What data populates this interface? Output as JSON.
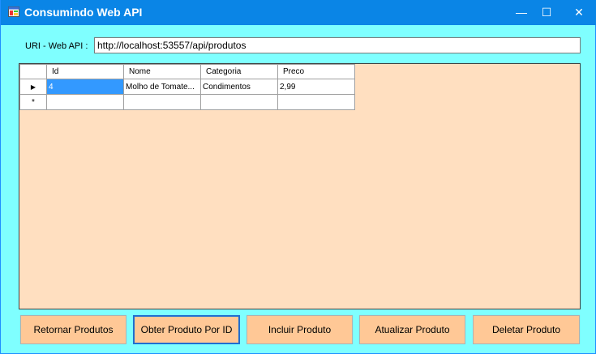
{
  "window": {
    "title": "Consumindo Web API",
    "controls": {
      "minimize": "—",
      "maximize": "☐",
      "close": "✕"
    }
  },
  "uri": {
    "label": "URI - Web API :",
    "value": "http://localhost:53557/api/produtos"
  },
  "grid": {
    "columns": [
      "Id",
      "Nome",
      "Categoria",
      "Preco"
    ],
    "rows": [
      {
        "marker": "▶",
        "id": "4",
        "nome": "Molho de Tomate...",
        "categoria": "Condimentos",
        "preco": "2,99"
      }
    ],
    "new_row_marker": "*"
  },
  "buttons": {
    "retornar": "Retornar Produtos",
    "obter": "Obter Produto Por ID",
    "incluir": "Incluir Produto",
    "atualizar": "Atualizar Produto",
    "deletar": "Deletar Produto"
  },
  "colors": {
    "titlebar": "#0a85e6",
    "form_background": "#7fffff",
    "grid_background": "#ffdfc0",
    "button_background": "#ffc896",
    "selection": "#3399ff"
  },
  "icons": [
    "app-icon",
    "minimize-icon",
    "maximize-icon",
    "close-icon",
    "row-pointer-icon"
  ]
}
